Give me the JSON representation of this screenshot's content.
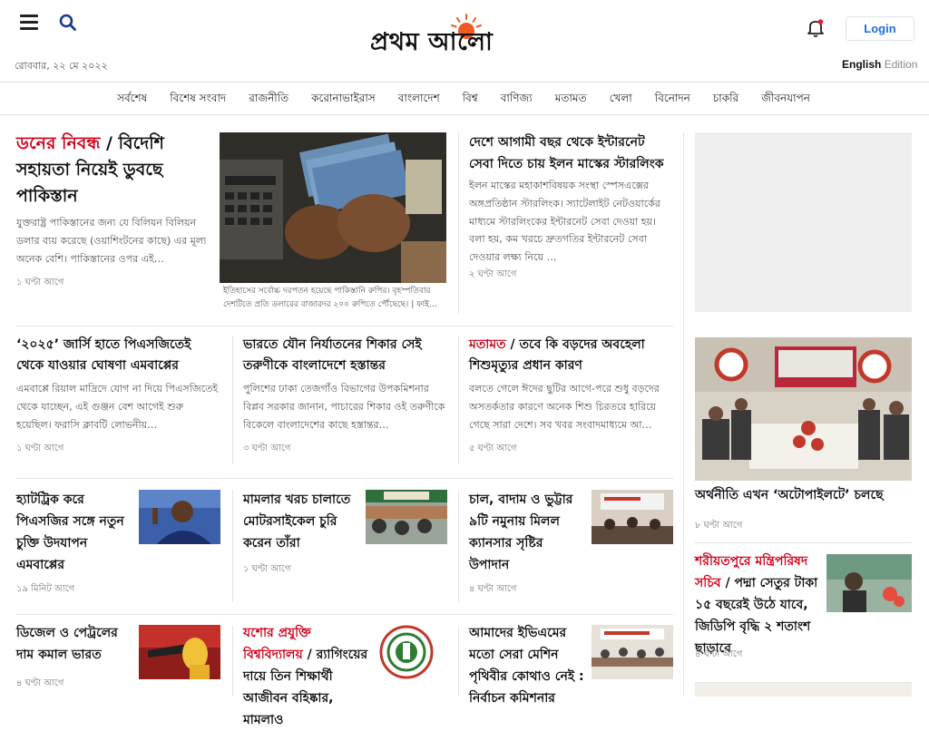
{
  "header": {
    "date": "রোববার, ২২ মে ২০২২",
    "logo_text": "প্রথম আলো",
    "login_label": "Login",
    "edition_en": "English",
    "edition_label": "Edition"
  },
  "nav": {
    "items": [
      "সর্বশেষ",
      "বিশেষ সংবাদ",
      "রাজনীতি",
      "করোনাভাইরাস",
      "বাংলাদেশ",
      "বিশ্ব",
      "বাণিজ্য",
      "মতামত",
      "খেলা",
      "বিনোদন",
      "চাকরি",
      "জীবনযাপন"
    ]
  },
  "lead": {
    "kicker": "ডনের নিবন্ধ",
    "sep": " / ",
    "title": "বিদেশি সহায়তা নিয়েই ডুবছে পাকিস্তান",
    "summary": "যুক্তরাষ্ট্র পাকিস্তানের জন্য যে বিলিয়ন বিলিয়ন ডলার ব্যয় করেছে (ওয়াশিংটনের কাছে) এর মূল্য অনেক বেশি। পাকিস্তানের ওপর এই…",
    "time": "১ ঘণ্টা আগে",
    "caption": "ইতিহাসের সর্বোচ্চ দরপতন হয়েছে পাকিস্তানি রুপির। বৃহস্পতিবার দেশটিতে প্রতি ডলারের বাজারদর ২০০ রুপিতে পৌঁছেছে। | ফাই…"
  },
  "starlink": {
    "title": "দেশে আগামী বছর থেকে ইন্টারনেট সেবা দিতে চায় ইলন মাস্কের স্টারলিংক",
    "summary": "ইলন মাস্কের মহাকাশবিষয়ক সংস্থা স্পেসএক্সের অঙ্গপ্রতিষ্ঠান স্টারলিংক। স্যাটেলাইট নেটওয়ার্কের মাধ্যমে স্টারলিংকের ইন্টারনেট সেবা দেওয়া হয়। বলা হয়, কম খরচে দ্রুতগতির ইন্টারনেট সেবা দেওয়ার লক্ষ্য নিয়ে …",
    "time": "২ ঘণ্টা আগে"
  },
  "row2": [
    {
      "kicker": "",
      "title": "‘২০২৫’ জার্সি হাতে পিএসজিতেই থেকে যাওয়ার ঘোষণা এমবাপ্পের",
      "summary": "এমবাপ্পে রিয়াল মাদ্রিদে যোগ না দিয়ে পিএসজিতেই থেকে যাচ্ছেন, এই গুঞ্জন বেশ আগেই শুরু হয়েছিল। ফরাসি ক্লাবটি লোভনীয়…",
      "time": "১ ঘণ্টা আগে"
    },
    {
      "kicker": "",
      "title": "ভারতে যৌন নির্যাতনের শিকার সেই তরুণীকে বাংলাদেশে হস্তান্তর",
      "summary": "পুলিশের ঢাকা তেজগাঁও বিভাগের উপকমিশনার বিপ্লব সরকার জানান, পাচারের শিকার ওই তরুণীকে বিকেলে বাংলাদেশের কাছে হস্তান্তর…",
      "time": "৩ ঘণ্টা আগে"
    },
    {
      "kicker": "মতামত",
      "title": "তবে কি বড়দের অবহেলা শিশুমৃত্যুর প্রধান কারণ",
      "summary": "বলতে গেলে ঈদের ছুটির আগে-পরে শুধু বড়দের অসতর্কতার কারণে অনেক শিশু চিরতরে হারিয়ে গেছে সারা দেশে। সব খবর সংবাদমাধ্যমে আ…",
      "time": "৫ ঘণ্টা আগে"
    }
  ],
  "row3": [
    {
      "title": "হ্যাটট্রিক করে পিএসজির সঙ্গে নতুন চুক্তি উদযাপন এমবাপ্পের",
      "time": "১৯ মিনিট আগে"
    },
    {
      "title": "মামলার খরচ চালাতে মোটরসাইকেল চুরি করেন তাঁরা",
      "time": "১ ঘণ্টা আগে"
    },
    {
      "title": "চাল, বাদাম ও ভুট্টার ৯টি নমুনায় মিলল ক্যানসার সৃষ্টির উপাদান",
      "time": "৪ ঘণ্টা আগে"
    }
  ],
  "row4": [
    {
      "kicker": "",
      "title": "ডিজেল ও পেট্রলের দাম কমাল ভারত",
      "time": "৪ ঘণ্টা আগে"
    },
    {
      "kicker": "যশোর প্রযুক্তি বিশ্ববিদ্যালয়",
      "title": "র‍্যাগিংয়ের দায়ে তিন শিক্ষার্থী আজীবন বহিষ্কার, মামলাও",
      "time": ""
    },
    {
      "kicker": "",
      "title": "আমাদের ইভিএমের মতো সেরা মেশিন পৃথিবীর কোথাও নেই : নির্বাচন কমিশনার",
      "time": ""
    }
  ],
  "side": {
    "item1_title": "অর্থনীতি এখন ‘অটোপাইলটে’ চলছে",
    "item1_time": "৮ ঘণ্টা আগে",
    "item2_kicker": "শরীয়তপুরে মন্ত্রিপরিষদ সচিব",
    "item2_title": "পদ্মা সেতুর টাকা ১৫ বছরেই উঠে যাবে, জিডিপি বৃদ্ধি ২ শতাংশ ছাড়াবে",
    "item2_time": "৪ ঘণ্টা আগে"
  },
  "colors": {
    "accent_red": "#d0021b",
    "link_blue": "#1f6fd8",
    "logo_sun": "#f15a24"
  }
}
